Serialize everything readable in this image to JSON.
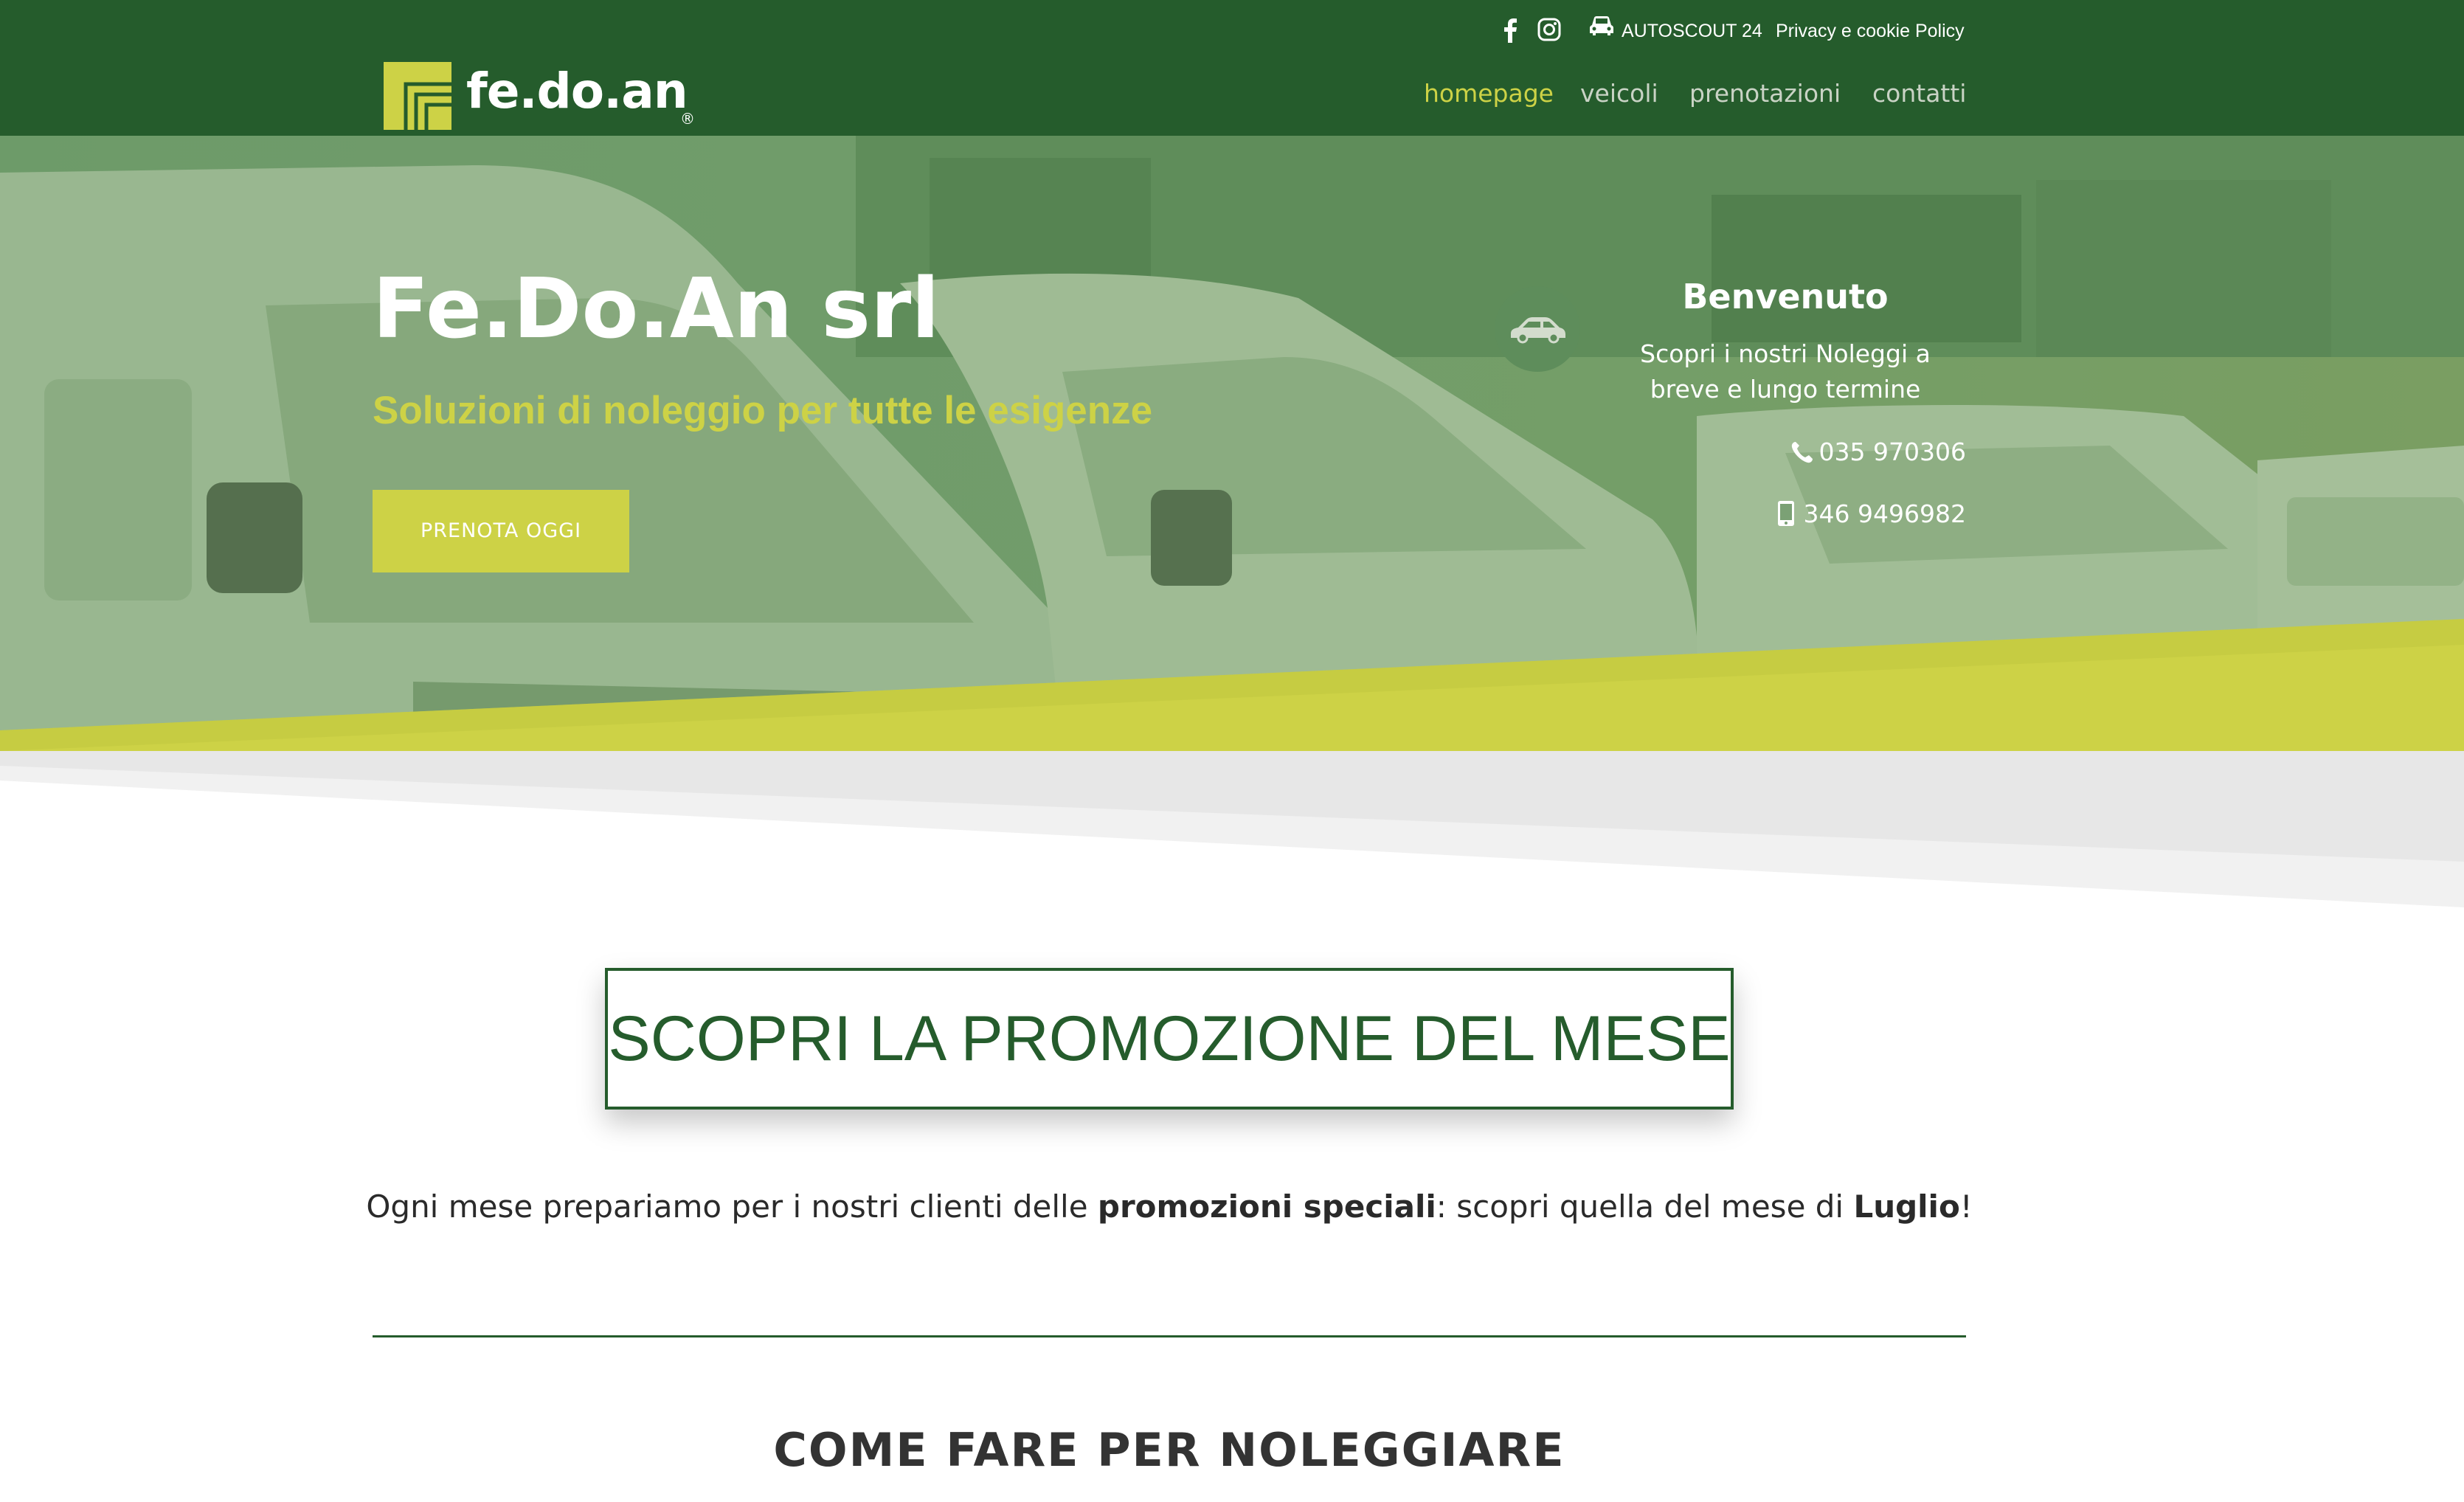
{
  "colors": {
    "header_bg": "#255c2c",
    "accent_lime": "#cdd246",
    "nav_inactive": "#c9d3c5",
    "white": "#ffffff"
  },
  "header": {
    "logo_text": "fe.do.an",
    "logo_reg": "®",
    "topbar": {
      "facebook_icon": "facebook-icon",
      "instagram_icon": "instagram-icon",
      "car_icon": "car-icon",
      "autoscout_label": "AUTOSCOUT 24",
      "privacy_label": "Privacy e cookie Policy"
    },
    "nav": [
      {
        "label": "homepage",
        "active": true
      },
      {
        "label": "veicoli",
        "active": false
      },
      {
        "label": "prenotazioni",
        "active": false
      },
      {
        "label": "contatti",
        "active": false
      }
    ]
  },
  "hero": {
    "title": "Fe.Do.An srl",
    "subtitle": "Soluzioni di noleggio per tutte le esigenze",
    "cta_label": "PRENOTA OGGI",
    "welcome": {
      "icon": "car-icon",
      "title": "Benvenuto",
      "text_line1": "Scopri i nostri Noleggi a",
      "text_line2": "breve e lungo termine",
      "phone_icon": "phone-icon",
      "phone": "035 970306",
      "mobile_icon": "mobile-phone-icon",
      "mobile": "346 9496982"
    }
  },
  "promo": {
    "box_title": "SCOPRI LA PROMOZIONE DEL MESE",
    "desc_part1": "Ogni mese prepariamo per i nostri clienti delle ",
    "desc_bold1": "promozioni speciali",
    "desc_part2": ": scopri quella del mese di ",
    "desc_bold2": "Luglio",
    "desc_part3": "!"
  },
  "how_to": {
    "title": "COME FARE PER NOLEGGIARE"
  }
}
